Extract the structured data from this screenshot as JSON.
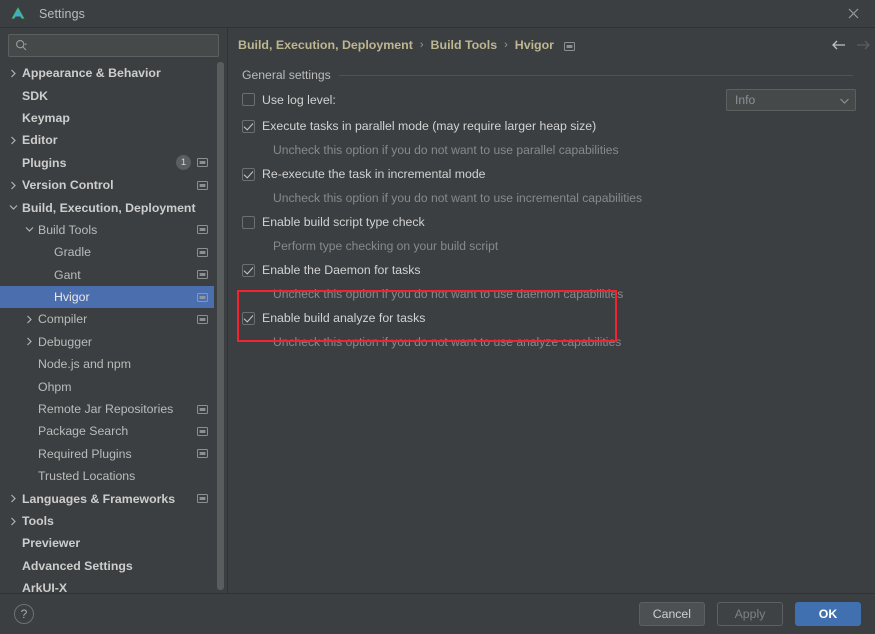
{
  "window": {
    "title": "Settings",
    "app_icon": "deveco-logo-icon",
    "close_icon": "close-icon"
  },
  "search": {
    "placeholder": "",
    "value": "",
    "icon": "search-icon"
  },
  "sidebar": {
    "items": [
      {
        "label": "Appearance & Behavior",
        "arrow": "chevron-right",
        "indent": 0,
        "bold": true,
        "badge": "",
        "mod": false,
        "selected": false
      },
      {
        "label": "SDK",
        "arrow": "none",
        "indent": 0,
        "bold": true,
        "badge": "",
        "mod": false,
        "selected": false
      },
      {
        "label": "Keymap",
        "arrow": "none",
        "indent": 0,
        "bold": true,
        "badge": "",
        "mod": false,
        "selected": false
      },
      {
        "label": "Editor",
        "arrow": "chevron-right",
        "indent": 0,
        "bold": true,
        "badge": "",
        "mod": false,
        "selected": false
      },
      {
        "label": "Plugins",
        "arrow": "none",
        "indent": 0,
        "bold": true,
        "badge": "1",
        "mod": true,
        "selected": false
      },
      {
        "label": "Version Control",
        "arrow": "chevron-right",
        "indent": 0,
        "bold": true,
        "badge": "",
        "mod": true,
        "selected": false
      },
      {
        "label": "Build, Execution, Deployment",
        "arrow": "chevron-down",
        "indent": 0,
        "bold": true,
        "badge": "",
        "mod": false,
        "selected": false
      },
      {
        "label": "Build Tools",
        "arrow": "chevron-down",
        "indent": 1,
        "bold": false,
        "badge": "",
        "mod": true,
        "selected": false
      },
      {
        "label": "Gradle",
        "arrow": "none",
        "indent": 2,
        "bold": false,
        "badge": "",
        "mod": true,
        "selected": false
      },
      {
        "label": "Gant",
        "arrow": "none",
        "indent": 2,
        "bold": false,
        "badge": "",
        "mod": true,
        "selected": false
      },
      {
        "label": "Hvigor",
        "arrow": "none",
        "indent": 2,
        "bold": false,
        "badge": "",
        "mod": true,
        "selected": true
      },
      {
        "label": "Compiler",
        "arrow": "chevron-right",
        "indent": 1,
        "bold": false,
        "badge": "",
        "mod": true,
        "selected": false
      },
      {
        "label": "Debugger",
        "arrow": "chevron-right",
        "indent": 1,
        "bold": false,
        "badge": "",
        "mod": false,
        "selected": false
      },
      {
        "label": "Node.js and npm",
        "arrow": "none",
        "indent": 1,
        "bold": false,
        "badge": "",
        "mod": false,
        "selected": false
      },
      {
        "label": "Ohpm",
        "arrow": "none",
        "indent": 1,
        "bold": false,
        "badge": "",
        "mod": false,
        "selected": false
      },
      {
        "label": "Remote Jar Repositories",
        "arrow": "none",
        "indent": 1,
        "bold": false,
        "badge": "",
        "mod": true,
        "selected": false
      },
      {
        "label": "Package Search",
        "arrow": "none",
        "indent": 1,
        "bold": false,
        "badge": "",
        "mod": true,
        "selected": false
      },
      {
        "label": "Required Plugins",
        "arrow": "none",
        "indent": 1,
        "bold": false,
        "badge": "",
        "mod": true,
        "selected": false
      },
      {
        "label": "Trusted Locations",
        "arrow": "none",
        "indent": 1,
        "bold": false,
        "badge": "",
        "mod": false,
        "selected": false
      },
      {
        "label": "Languages & Frameworks",
        "arrow": "chevron-right",
        "indent": 0,
        "bold": true,
        "badge": "",
        "mod": true,
        "selected": false
      },
      {
        "label": "Tools",
        "arrow": "chevron-right",
        "indent": 0,
        "bold": true,
        "badge": "",
        "mod": false,
        "selected": false
      },
      {
        "label": "Previewer",
        "arrow": "none",
        "indent": 0,
        "bold": true,
        "badge": "",
        "mod": false,
        "selected": false
      },
      {
        "label": "Advanced Settings",
        "arrow": "none",
        "indent": 0,
        "bold": true,
        "badge": "",
        "mod": false,
        "selected": false
      },
      {
        "label": "ArkUI-X",
        "arrow": "none",
        "indent": 0,
        "bold": true,
        "badge": "",
        "mod": false,
        "selected": false
      }
    ]
  },
  "breadcrumb": {
    "parts": [
      "Build, Execution, Deployment",
      "Build Tools",
      "Hvigor"
    ],
    "separator": "›",
    "modified_icon": "module-settings-icon",
    "back_icon": "arrow-left-icon",
    "forward_icon": "arrow-right-icon"
  },
  "main": {
    "group_title": "General settings",
    "log_level": {
      "label": "Use log level:",
      "checked": false,
      "selected_option": "Info",
      "options": [
        "Info"
      ],
      "chevron_icon": "chevron-down-icon"
    },
    "options": [
      {
        "label": "Execute tasks in parallel mode (may require larger heap size)",
        "checked": true,
        "hint": "Uncheck this option if you do not want to use parallel capabilities",
        "highlighted": false
      },
      {
        "label": "Re-execute the task in incremental mode",
        "checked": true,
        "hint": "Uncheck this option if you do not want to use incremental capabilities",
        "highlighted": false
      },
      {
        "label": "Enable build script type check",
        "checked": false,
        "hint": "Perform type checking on your build script",
        "highlighted": false
      },
      {
        "label": "Enable the Daemon for tasks",
        "checked": true,
        "hint": "Uncheck this option if you do not want to use daemon capabilities",
        "highlighted": false
      },
      {
        "label": "Enable build analyze for tasks",
        "checked": true,
        "hint": "Uncheck this option if you do not want to use analyze capabilities",
        "highlighted": true
      }
    ]
  },
  "footer": {
    "help_label": "?",
    "cancel_label": "Cancel",
    "apply_label": "Apply",
    "ok_label": "OK"
  },
  "colors": {
    "window_bg": "#3c3f41",
    "selection_blue": "#4b6eaf",
    "primary_button": "#4070b0",
    "breadcrumb_text": "#bdb68f",
    "highlight_red": "#f5222d",
    "hint_text": "#868a8c"
  }
}
